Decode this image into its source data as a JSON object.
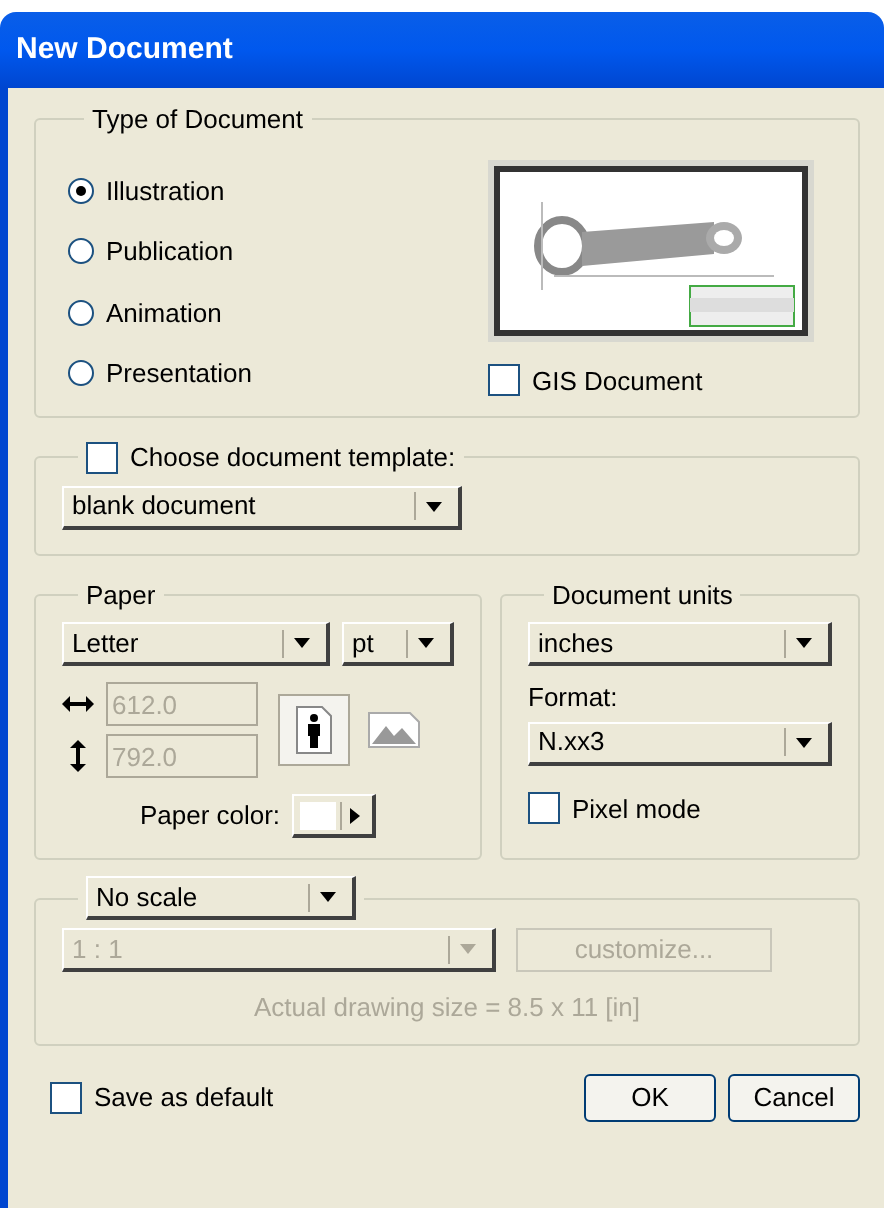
{
  "window": {
    "title": "New Document"
  },
  "document_type": {
    "label": "Type of Document",
    "options": [
      {
        "label": "Illustration",
        "selected": true
      },
      {
        "label": "Publication",
        "selected": false
      },
      {
        "label": "Animation",
        "selected": false
      },
      {
        "label": "Presentation",
        "selected": false
      }
    ],
    "gis_document": {
      "label": "GIS Document",
      "checked": false
    }
  },
  "template": {
    "label": "Choose document template:",
    "checked": false,
    "value": "blank document"
  },
  "paper": {
    "label": "Paper",
    "size": "Letter",
    "unit": "pt",
    "width": {
      "value": "612.0",
      "disabled": true
    },
    "height": {
      "value": "792.0",
      "disabled": true
    },
    "orientation": [
      {
        "kind": "portrait",
        "selected": true
      },
      {
        "kind": "landscape",
        "selected": false
      }
    ],
    "color_label": "Paper color:"
  },
  "units": {
    "label": "Document units",
    "value": "inches",
    "format_label": "Format:",
    "format": "N.xx3",
    "pixel_mode": {
      "label": "Pixel mode",
      "checked": false
    }
  },
  "scale": {
    "value": "No scale",
    "ratio": {
      "value": "1 : 1",
      "disabled": true
    },
    "customize": {
      "label": "customize...",
      "disabled": true
    },
    "actual_size": {
      "text": "Actual drawing size = 8.5 x 11 [in]",
      "disabled": true
    }
  },
  "save_default": {
    "label": "Save as default",
    "checked": false
  },
  "buttons": [
    "OK",
    "Cancel"
  ]
}
